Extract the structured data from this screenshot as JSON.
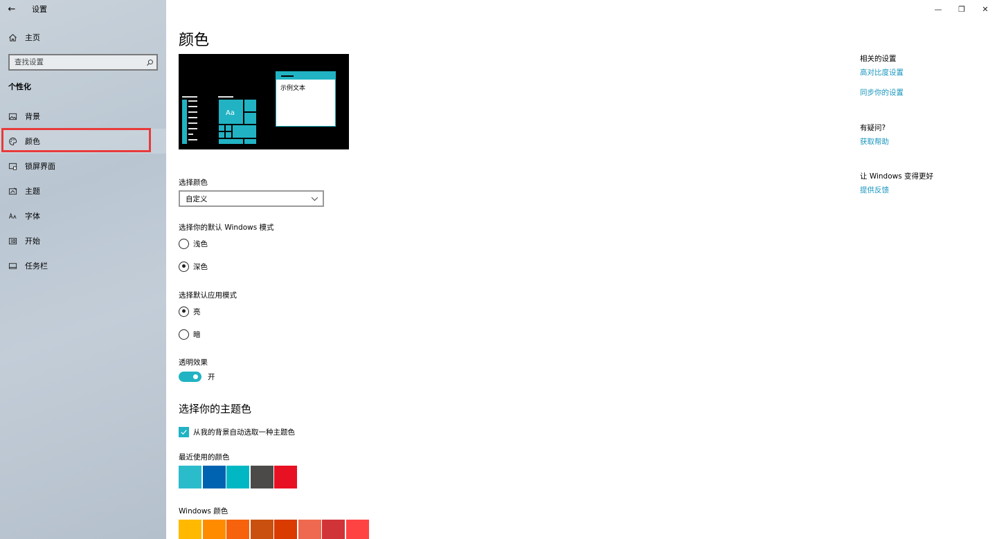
{
  "window": {
    "title": "设置",
    "back_icon": "←"
  },
  "window_controls": {
    "minimize": "—",
    "restore": "❐",
    "close": "✕"
  },
  "sidebar": {
    "home_label": "主页",
    "search_placeholder": "查找设置",
    "section_header": "个性化",
    "items": [
      {
        "label": "背景",
        "icon": "picture-icon"
      },
      {
        "label": "颜色",
        "icon": "palette-icon",
        "selected": true
      },
      {
        "label": "锁屏界面",
        "icon": "lock-screen-icon"
      },
      {
        "label": "主题",
        "icon": "theme-icon"
      },
      {
        "label": "字体",
        "icon": "font-icon"
      },
      {
        "label": "开始",
        "icon": "start-icon"
      },
      {
        "label": "任务栏",
        "icon": "taskbar-icon"
      }
    ]
  },
  "main": {
    "title": "颜色",
    "preview": {
      "sample_text": "示例文本",
      "tile_text": "Aa"
    },
    "choose_color": {
      "label": "选择颜色",
      "value": "自定义"
    },
    "windows_mode": {
      "label": "选择你的默认 Windows 模式",
      "options": [
        "浅色",
        "深色"
      ],
      "selected": "深色"
    },
    "app_mode": {
      "label": "选择默认应用模式",
      "options": [
        "亮",
        "暗"
      ],
      "selected": "亮"
    },
    "transparency": {
      "label": "透明效果",
      "state": "开",
      "on": true
    },
    "accent": {
      "title": "选择你的主题色",
      "auto_pick_label": "从我的背景自动选取一种主题色",
      "auto_pick_checked": true,
      "recent_label": "最近使用的颜色",
      "recent_colors": [
        "#2bbccc",
        "#0063b1",
        "#00b7c3",
        "#4c4a48",
        "#e81123"
      ],
      "windows_label": "Windows 颜色",
      "windows_colors": [
        "#ffb900",
        "#ff8c00",
        "#f7630c",
        "#ca5010",
        "#da3b01",
        "#ef6950",
        "#d13438",
        "#ff4343"
      ]
    }
  },
  "right_column": {
    "related_heading": "相关的设置",
    "high_contrast_link": "高对比度设置",
    "sync_link": "同步你的设置",
    "question_heading": "有疑问?",
    "help_link": "获取帮助",
    "improve_heading": "让 Windows 变得更好",
    "feedback_link": "提供反馈"
  },
  "colors": {
    "accent": "#21b3c3",
    "link": "#1a96bf",
    "highlight": "#e83a3a"
  }
}
